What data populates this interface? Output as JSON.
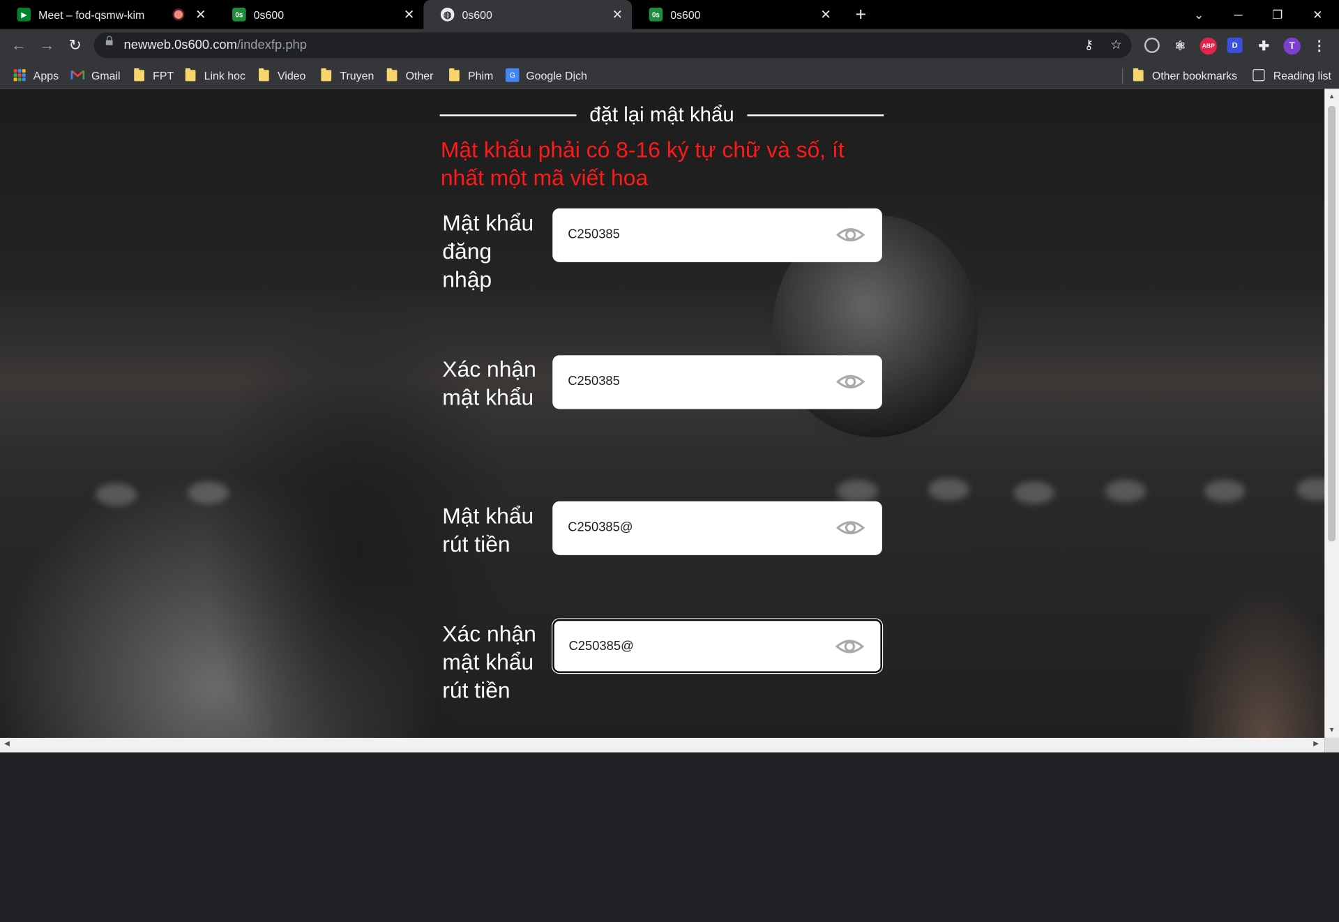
{
  "tabs": [
    {
      "title": "Meet – fod-qsmw-kim",
      "icon": "google-meet-icon",
      "recording": true,
      "active": false
    },
    {
      "title": "0s600",
      "icon": "os-site-icon",
      "active": false
    },
    {
      "title": "0s600",
      "icon": "globe-icon",
      "active": true
    },
    {
      "title": "0s600",
      "icon": "os-site-icon",
      "active": false
    }
  ],
  "address_bar": {
    "host": "newweb.0s600.com",
    "path": "/indexfp.php"
  },
  "bookmarks": {
    "apps": "Apps",
    "gmail": "Gmail",
    "folders": [
      "FPT",
      "Link hoc",
      "Video",
      "Truyen",
      "Other",
      "Phim"
    ],
    "google_dich": "Google Dịch",
    "other_bookmarks": "Other bookmarks",
    "reading_list": "Reading list"
  },
  "profile_initial": "T",
  "extensions": {
    "abp": "ABP",
    "d": "D"
  },
  "page": {
    "heading": "đặt lại mật khẩu",
    "warning": "Mật khẩu phải có 8-16 ký tự chữ và số, ít nhất một mã viết hoa",
    "fields": [
      {
        "label": "Mật khẩu đăng nhập",
        "value": "C250385"
      },
      {
        "label": "Xác nhận mật khẩu",
        "value": "C250385"
      },
      {
        "label": "Mật khẩu rút tiền",
        "value": "C250385@"
      },
      {
        "label": "Xác nhận mật khẩu rút tiền",
        "value": "C250385@",
        "focused": true
      }
    ]
  },
  "colors": {
    "warning": "#ff1a1a",
    "tabstrip": "#000000",
    "toolbar": "#35363a"
  }
}
